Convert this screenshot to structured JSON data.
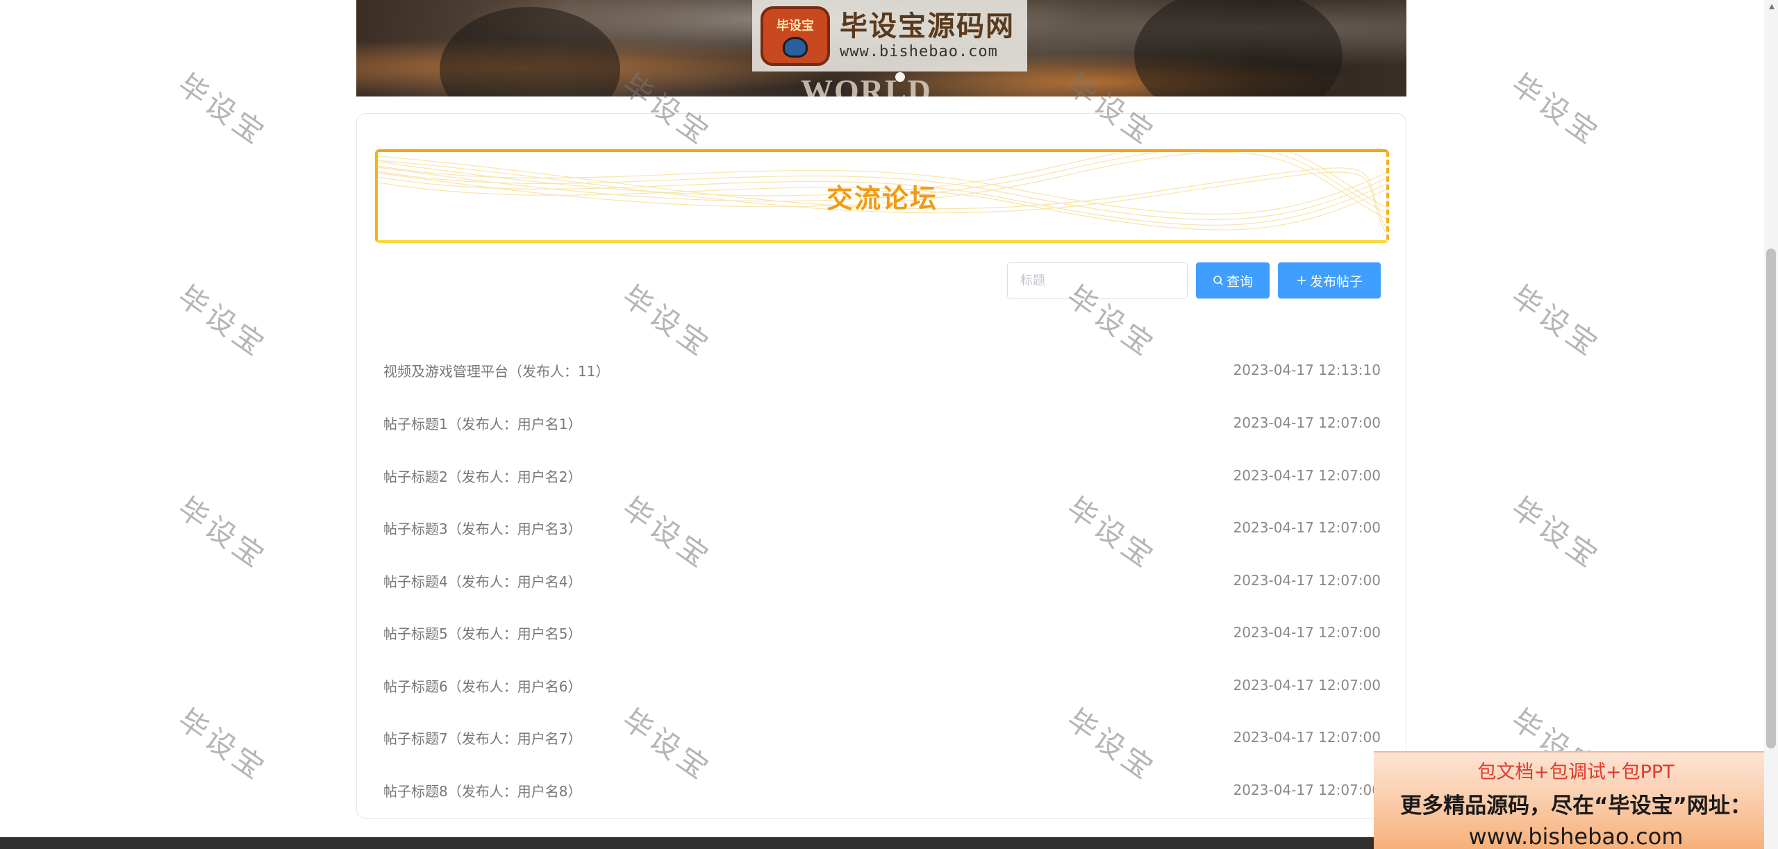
{
  "banner": {
    "logo_badge": "毕设宝",
    "logo_title": "毕设宝源码网",
    "logo_url": "www.bishebao.com",
    "background_word": "WORLD",
    "carousel_active_index": 0
  },
  "forum": {
    "title": "交流论坛",
    "search_placeholder": "标题",
    "search_button": "查询",
    "add_button": "发布帖子"
  },
  "posts": [
    {
      "title": "视频及游戏管理平台（发布人：11）",
      "date": "2023-04-17 12:13:10"
    },
    {
      "title": "帖子标题1（发布人：用户名1）",
      "date": "2023-04-17 12:07:00"
    },
    {
      "title": "帖子标题2（发布人：用户名2）",
      "date": "2023-04-17 12:07:00"
    },
    {
      "title": "帖子标题3（发布人：用户名3）",
      "date": "2023-04-17 12:07:00"
    },
    {
      "title": "帖子标题4（发布人：用户名4）",
      "date": "2023-04-17 12:07:00"
    },
    {
      "title": "帖子标题5（发布人：用户名5）",
      "date": "2023-04-17 12:07:00"
    },
    {
      "title": "帖子标题6（发布人：用户名6）",
      "date": "2023-04-17 12:07:00"
    },
    {
      "title": "帖子标题7（发布人：用户名7）",
      "date": "2023-04-17 12:07:00"
    },
    {
      "title": "帖子标题8（发布人：用户名8）",
      "date": "2023-04-17 12:07:00"
    }
  ],
  "watermark": "毕设宝",
  "promo": {
    "line1": "包文档+包调试+包PPT",
    "line2": "更多精品源码，尽在“毕设宝”网址：",
    "line3": "www.bishebao.com"
  },
  "colors": {
    "primary": "#409eff",
    "title_accent": "#f29a12",
    "border_accent": "#f5b318"
  }
}
